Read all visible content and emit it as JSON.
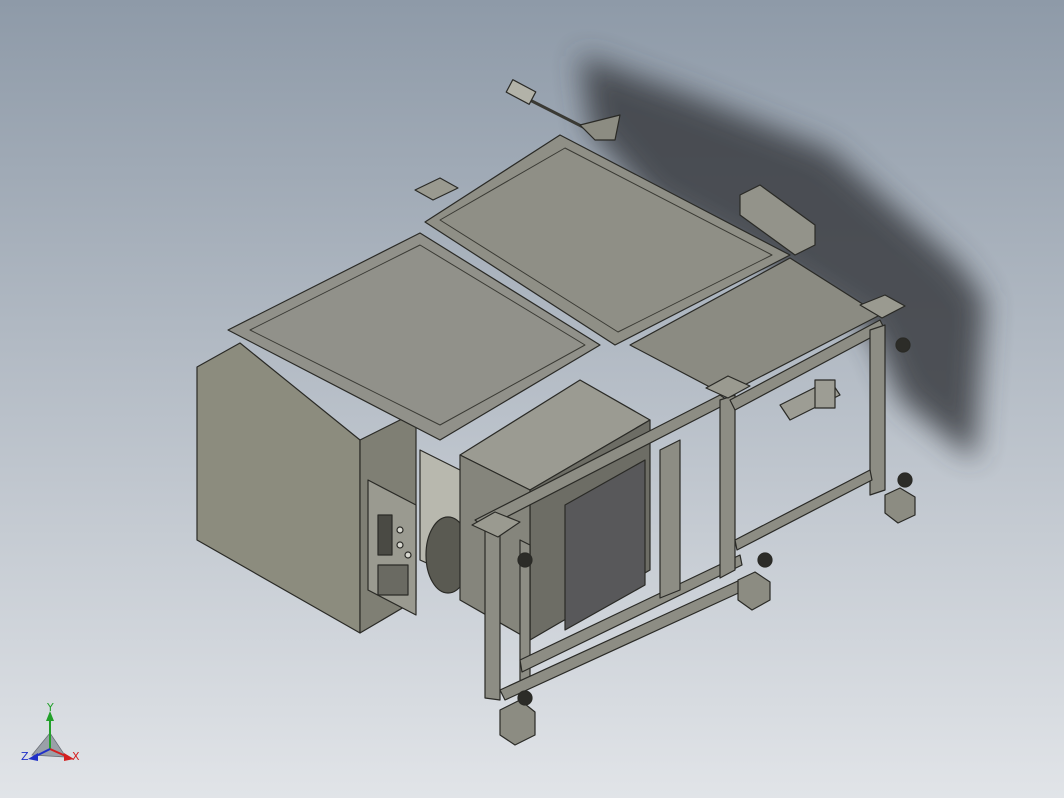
{
  "viewport": {
    "background_top": "#8e9aa8",
    "background_bottom": "#dfe2e6",
    "model_color": "#8b8b7d",
    "edge_color": "#2a2a26",
    "shadow_color": "#3c3e42"
  },
  "triad": {
    "x_label": "X",
    "y_label": "Y",
    "z_label": "Z",
    "x_color": "#d42020",
    "y_color": "#22a02a",
    "z_color": "#2030c8"
  }
}
